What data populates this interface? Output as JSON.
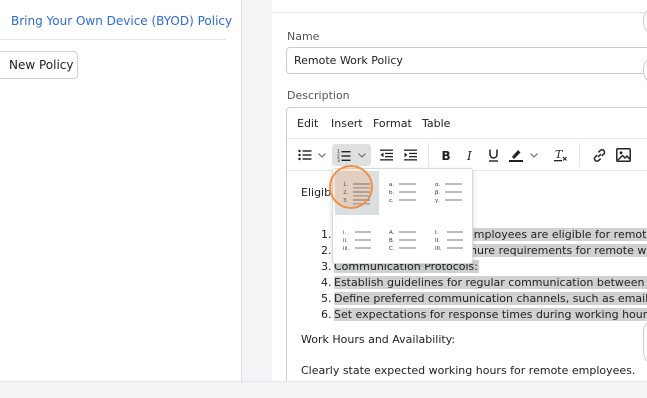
{
  "sidebar": {
    "policy_link": "Bring Your Own Device (BYOD) Policy",
    "new_policy_button": "New Policy"
  },
  "form": {
    "name_label": "Name",
    "name_value": "Remote Work Policy",
    "description_label": "Description"
  },
  "editor": {
    "menu": [
      "Edit",
      "Insert",
      "Format",
      "Table"
    ],
    "toolbar_icons": [
      "bullet-list-icon",
      "chevron-down-icon",
      "numbered-list-icon",
      "chevron-down-icon",
      "outdent-icon",
      "indent-icon",
      "bold-icon",
      "italic-icon",
      "underline-icon",
      "highlight-icon",
      "chevron-down-icon",
      "clear-format-icon",
      "link-icon",
      "image-icon"
    ],
    "content": {
      "heading": "Eligibi",
      "list_numbers": [
        "1.",
        "2.",
        "3.",
        "4.",
        "5.",
        "6."
      ],
      "list_items": [
        "r employees are eligible for remote",
        "tenure requirements for remote w",
        "Communication Protocols:",
        "Establish guidelines for regular communication between remo",
        "Define preferred communication channels, such as email, video",
        "Set expectations for response times during working hours"
      ],
      "paragraph1": "Work Hours and Availability:",
      "paragraph2": "Clearly state expected working hours for remote employees."
    }
  },
  "numbered_list_dropdown": {
    "options": [
      {
        "style": "decimal",
        "markers": [
          "1.",
          "2.",
          "3."
        ],
        "selected": true
      },
      {
        "style": "lower-alpha",
        "markers": [
          "a.",
          "b.",
          "c."
        ],
        "selected": false
      },
      {
        "style": "lower-greek",
        "markers": [
          "α.",
          "β.",
          "γ."
        ],
        "selected": false
      },
      {
        "style": "lower-roman",
        "markers": [
          "i.",
          "ii.",
          "iii."
        ],
        "selected": false
      },
      {
        "style": "upper-alpha",
        "markers": [
          "A.",
          "B.",
          "C."
        ],
        "selected": false
      },
      {
        "style": "upper-roman",
        "markers": [
          "I.",
          "II.",
          "III."
        ],
        "selected": false
      }
    ]
  },
  "colors": {
    "link": "#2b6cd8",
    "selection": "#cfd1d3",
    "highlight_ring": "#f0914a"
  }
}
